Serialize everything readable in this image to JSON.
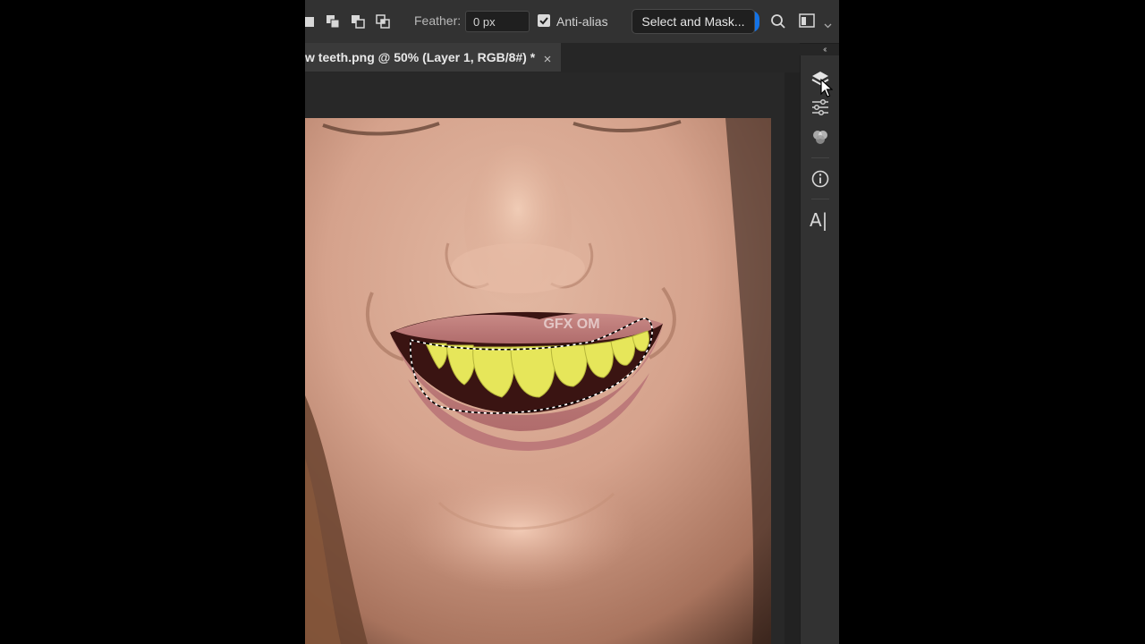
{
  "options_bar": {
    "selection_modes": [
      "new-selection",
      "add-to-selection",
      "subtract-from-selection",
      "intersect-with-selection"
    ],
    "feather_label": "Feather:",
    "feather_value": "0 px",
    "anti_alias_label": "Anti-alias",
    "anti_alias_checked": true,
    "select_and_mask_label": "Select and Mask...",
    "accent_color": "#1473e6",
    "icons": [
      "search-icon",
      "workspace-icon",
      "chevron-down-icon"
    ]
  },
  "document": {
    "tab_title": "w teeth.png @ 50% (Layer 1, RGB/8#) *",
    "close_glyph": "×"
  },
  "panel_collapse_glyph": "‹‹",
  "canvas": {
    "watermark": "GFX OM",
    "selection_outline": "marching-ants around teeth"
  },
  "icon_strip": {
    "buttons": [
      "layers-icon",
      "adjustments-icon",
      "channels-icon",
      "info-icon",
      "character-icon"
    ],
    "type_label": "A|"
  },
  "colors": {
    "app_background": "#262626",
    "options_bar": "#323232",
    "input_background": "#1f1f1f",
    "text": "#d2d2d2"
  }
}
